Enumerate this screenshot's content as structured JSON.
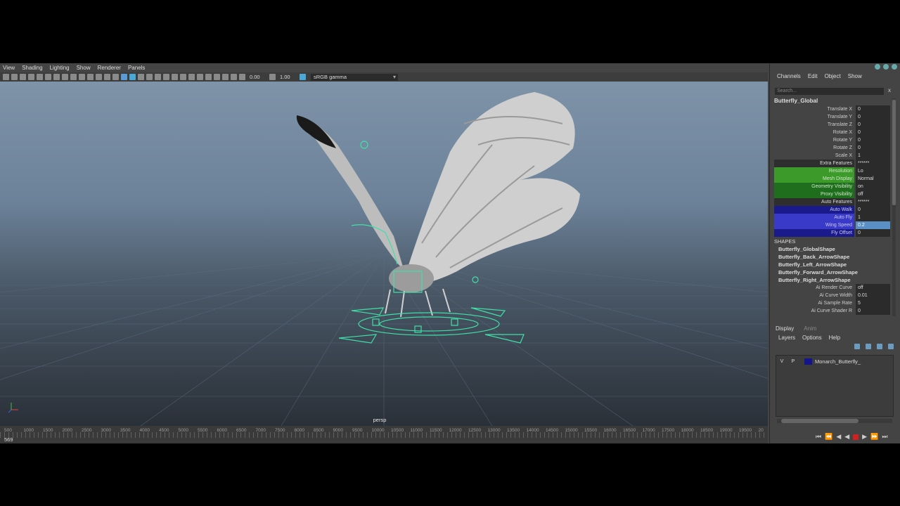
{
  "viewport": {
    "menu": [
      "View",
      "Shading",
      "Lighting",
      "Show",
      "Renderer",
      "Panels"
    ],
    "toolbar": {
      "value_a": "0.00",
      "value_b": "1.00",
      "color_space": "sRGB gamma"
    },
    "camera_label": "persp"
  },
  "timeline": {
    "tick_labels": [
      "500",
      "1000",
      "1500",
      "2000",
      "2500",
      "3000",
      "3500",
      "4000",
      "4500",
      "5000",
      "5500",
      "6000",
      "6500",
      "7000",
      "7500",
      "8000",
      "8500",
      "9000",
      "9500",
      "10000",
      "10500",
      "11000",
      "11500",
      "12000",
      "12500",
      "13000",
      "13500",
      "14000",
      "14500",
      "15000",
      "15500",
      "16000",
      "16500",
      "17000",
      "17500",
      "18000",
      "18500",
      "19000",
      "19500",
      "20"
    ],
    "current_frame": "569"
  },
  "channel_box": {
    "menus": [
      "Channels",
      "Edit",
      "Object",
      "Show"
    ],
    "search_placeholder": "Search...",
    "search_clear": "x",
    "node_name": "Butterfly_Global",
    "channels": [
      {
        "name": "Translate X",
        "value": "0",
        "style": "plain"
      },
      {
        "name": "Translate Y",
        "value": "0",
        "style": "plain"
      },
      {
        "name": "Translate Z",
        "value": "0",
        "style": "plain"
      },
      {
        "name": "Rotate X",
        "value": "0",
        "style": "plain"
      },
      {
        "name": "Rotate Y",
        "value": "0",
        "style": "plain"
      },
      {
        "name": "Rotate Z",
        "value": "0",
        "style": "plain"
      },
      {
        "name": "Scale X",
        "value": "1",
        "style": "plain"
      },
      {
        "name": "Extra Features",
        "value": "******",
        "style": "section"
      },
      {
        "name": "Resolution",
        "value": "Lo",
        "style": "green"
      },
      {
        "name": "Mesh Display",
        "value": "Normal",
        "style": "green"
      },
      {
        "name": "Geometry Visibility",
        "value": "on",
        "style": "green2"
      },
      {
        "name": "Proxy Visibility",
        "value": "off",
        "style": "green2"
      },
      {
        "name": "Auto Features",
        "value": "******",
        "style": "section"
      },
      {
        "name": "Auto Walk",
        "value": "0",
        "style": "blue"
      },
      {
        "name": "Auto Fly",
        "value": "1",
        "style": "blue2"
      },
      {
        "name": "Wing Speed",
        "value": "0.2",
        "style": "blue2 hl"
      },
      {
        "name": "Fly Offset",
        "value": "0",
        "style": "blue"
      }
    ],
    "shapes_header": "SHAPES",
    "shapes": [
      "Butterfly_GlobalShape",
      "Butterfly_Back_ArrowShape",
      "Butterfly_Left_ArrowShape",
      "Butterfly_Forward_ArrowShape",
      "Butterfly_Right_ArrowShape"
    ],
    "shape_attrs": [
      {
        "name": "Ai Render Curve",
        "value": "off"
      },
      {
        "name": "Ai Curve Width",
        "value": "0.01"
      },
      {
        "name": "Ai Sample Rate",
        "value": "5"
      },
      {
        "name": "Ai Curve Shader R",
        "value": "0"
      }
    ]
  },
  "layer_editor": {
    "tabs": [
      "Display",
      "Anim"
    ],
    "menus": [
      "Layers",
      "Options",
      "Help"
    ],
    "layer": {
      "v": "V",
      "p": "P",
      "name": "Monarch_Butterfly_"
    }
  }
}
